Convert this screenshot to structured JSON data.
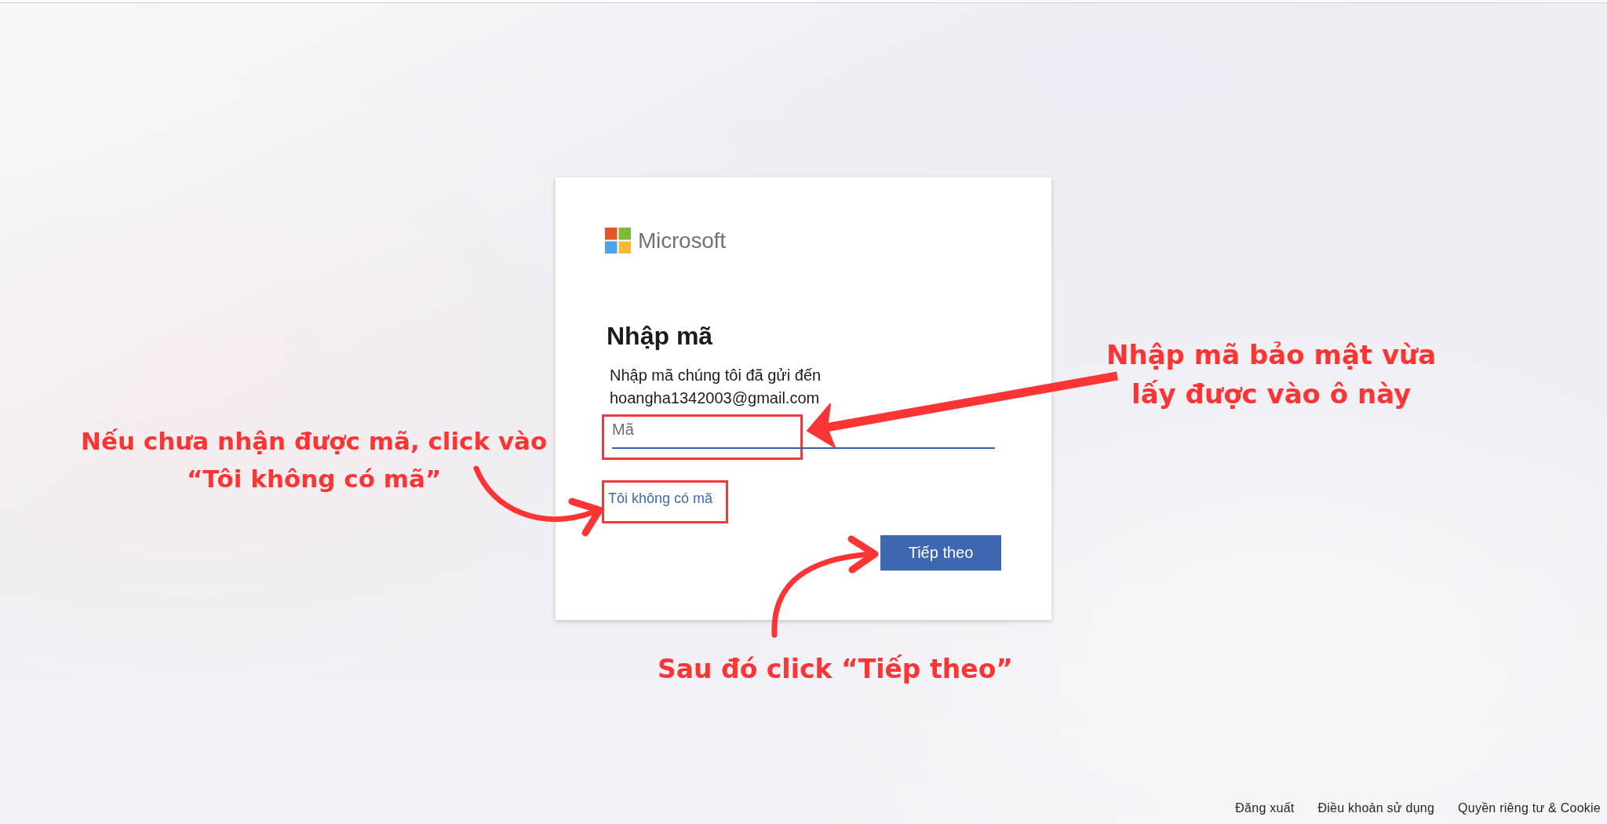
{
  "card": {
    "logo_text": "Microsoft",
    "title": "Nhập mã",
    "instruction": "Nhập mã chúng tôi đã gửi đến",
    "email": "hoangha1342003@gmail.com",
    "code_field": {
      "placeholder": "Mã",
      "highlighted": true
    },
    "link": {
      "label": "Tôi không có mã",
      "highlighted": true
    },
    "button": {
      "label": "Tiếp theo"
    }
  },
  "annotations": [
    {
      "kind": "field",
      "text": "Nhập mã bảo mật vừa\nlấy được vào ô này"
    },
    {
      "kind": "link",
      "text": "Nếu chưa nhận được mã, click vào\n“Tôi không có mã”"
    },
    {
      "kind": "button",
      "text": "Sau đó click “Tiếp theo”"
    }
  ],
  "footer": {
    "links": [
      "Đăng xuất",
      "Điều khoản sử dụng",
      "Quyền riêng tư & Cookie"
    ]
  }
}
